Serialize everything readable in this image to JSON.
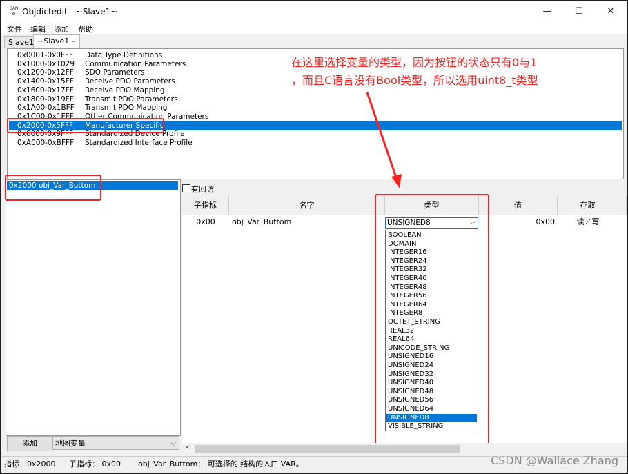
{
  "window": {
    "title": "Objdictedit - ~Slave1~",
    "app_icon_text": "CAN",
    "controls": {
      "minimize": "—",
      "maximize": "☐",
      "close": "✕"
    }
  },
  "menu": [
    "文件",
    "编辑",
    "添加",
    "帮助"
  ],
  "tabs": [
    {
      "label": "Slave1",
      "active": false
    },
    {
      "label": "~Slave1~",
      "active": true
    }
  ],
  "ranges": [
    {
      "code": "0x0001-0x0FFF",
      "name": "Data Type Definitions",
      "selected": false
    },
    {
      "code": "0x1000-0x1029",
      "name": "Communication Parameters",
      "selected": false
    },
    {
      "code": "0x1200-0x12FF",
      "name": "SDO Parameters",
      "selected": false
    },
    {
      "code": "0x1400-0x15FF",
      "name": "Receive PDO Parameters",
      "selected": false
    },
    {
      "code": "0x1600-0x17FF",
      "name": "Receive PDO Mapping",
      "selected": false
    },
    {
      "code": "0x1800-0x19FF",
      "name": "Transmit PDO Parameters",
      "selected": false
    },
    {
      "code": "0x1A00-0x1BFF",
      "name": "Transmit PDO Mapping",
      "selected": false
    },
    {
      "code": "0x1C00-0x1FFF",
      "name": "Other Communication Parameters",
      "selected": false
    },
    {
      "code": "0x2000-0x5FFF",
      "name": "Manufacturer Specific",
      "selected": true
    },
    {
      "code": "0x6000-0x9FFF",
      "name": "Standardized Device Profile",
      "selected": false
    },
    {
      "code": "0xA000-0xBFFF",
      "name": "Standardized Interface Profile",
      "selected": false
    }
  ],
  "annotation": {
    "line1": "在这里选择变量的类型，因为按钮的状态只有0与1",
    "line2": "，而且C语言没有Bool类型，所以选用uint8_t类型",
    "color": "#ff2020"
  },
  "index_list": {
    "items": [
      {
        "label": "0x2000   obj_Var_Buttom",
        "selected": true
      }
    ]
  },
  "bottom_left": {
    "add_label": "添加",
    "combo_value": "地图变量"
  },
  "checkbox_label": "有回访",
  "grid": {
    "headers": [
      "子指标",
      "名字",
      "类型",
      "值",
      "存取"
    ],
    "row": {
      "subindex": "0x00",
      "name": "obj_Var_Buttom",
      "type": "UNSIGNED8",
      "value": "0x00",
      "access": "读／写"
    }
  },
  "type_options": [
    "BOOLEAN",
    "DOMAIN",
    "INTEGER16",
    "INTEGER24",
    "INTEGER32",
    "INTEGER40",
    "INTEGER48",
    "INTEGER56",
    "INTEGER64",
    "INTEGER8",
    "OCTET_STRING",
    "REAL32",
    "REAL64",
    "UNICODE_STRING",
    "UNSIGNED16",
    "UNSIGNED24",
    "UNSIGNED32",
    "UNSIGNED40",
    "UNSIGNED48",
    "UNSIGNED56",
    "UNSIGNED64",
    "UNSIGNED8",
    "VISIBLE_STRING"
  ],
  "selected_type": "UNSIGNED8",
  "status": {
    "index": "指标：0x2000",
    "subindex": "子指标：  0x00",
    "description": "obj_Var_Buttom：  可选择的 结构的入口 VAR。"
  },
  "watermark": "CSDN @Wallace Zhang",
  "colors": {
    "selection": "#0078d7",
    "highlight_box": "#e8272b"
  }
}
